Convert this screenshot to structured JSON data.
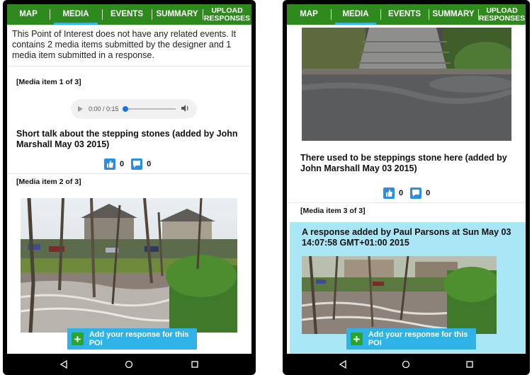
{
  "tabs": [
    {
      "label": "MAP"
    },
    {
      "label": "MEDIA"
    },
    {
      "label": "EVENTS"
    },
    {
      "label": "SUMMARY"
    },
    {
      "label": "UPLOAD RESPONSES"
    }
  ],
  "active_tab": "MEDIA",
  "intro": "This Point of Interest does not have any related events. It contains 2 media items submitted by the designer and 1 media item submitted in a response.",
  "media": [
    {
      "label": "[Media item 1 of 3]",
      "audio_time": "0:00 / 0:15",
      "title": "Short talk about the stepping stones (added by John Marshall May 03 2015)",
      "likes": "0",
      "comments": "0"
    },
    {
      "label": "[Media item 2 of 3]",
      "title": "There used to be steppings stone here (added by John Marshall May 03 2015)",
      "likes": "0",
      "comments": "0"
    },
    {
      "label": "[Media item 3 of 3]",
      "title": "A response added by Paul Parsons at Sun May 03 14:07:58 GMT+01:00 2015"
    }
  ],
  "add_response": "Add your response for this POI",
  "colors": {
    "topbar": "#2f8a1e",
    "accent": "#33b5e5",
    "response_bg": "#a9e6f6",
    "vote_button": "#2a8fe2"
  }
}
